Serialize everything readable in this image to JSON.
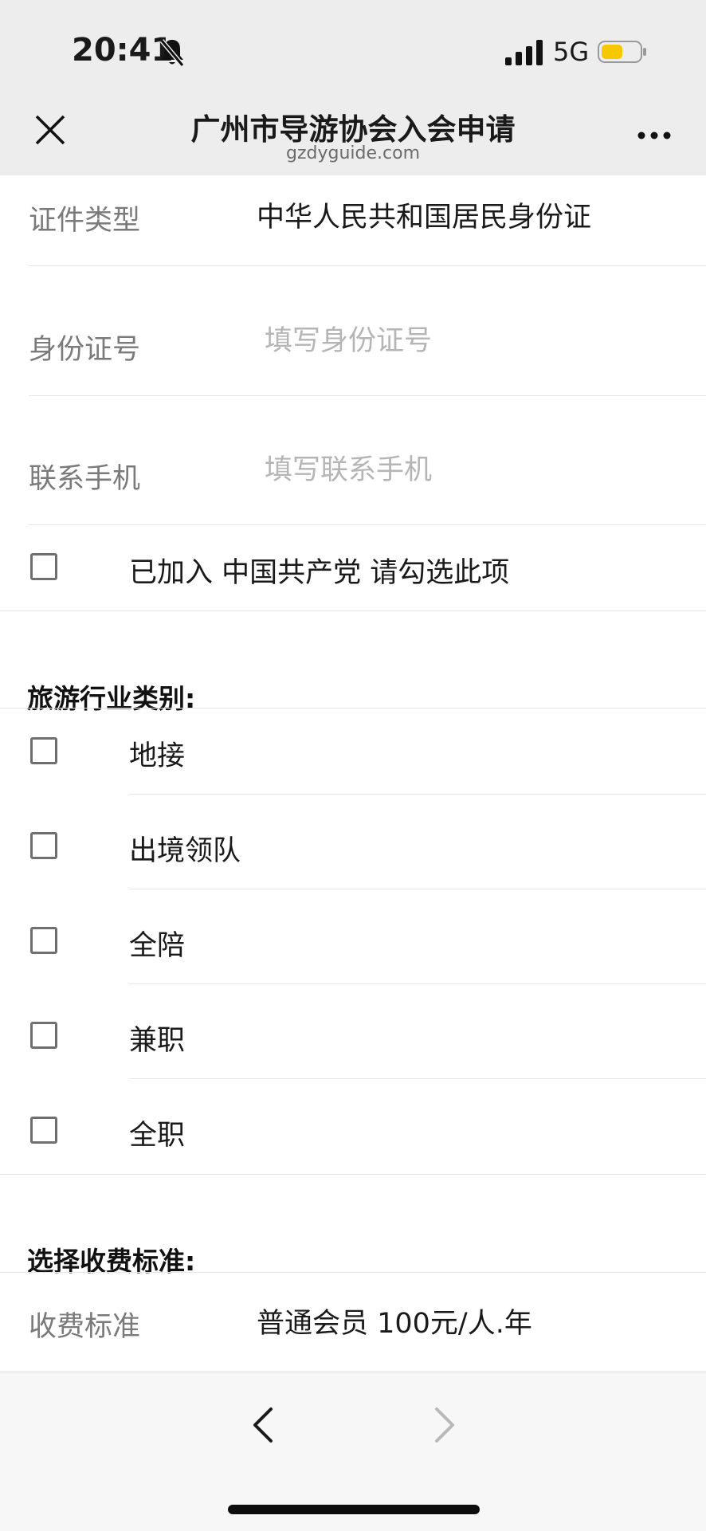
{
  "status_bar": {
    "time": "20:41",
    "network": "5G"
  },
  "nav": {
    "title": "广州市导游协会入会申请",
    "subtitle": "gzdyguide.com"
  },
  "form": {
    "id_type": {
      "label": "证件类型",
      "value": "中华人民共和国居民身份证"
    },
    "id_number": {
      "label": "身份证号",
      "placeholder": "填写身份证号"
    },
    "phone": {
      "label": "联系手机",
      "placeholder": "填写联系手机"
    },
    "party_member": {
      "label": "已加入 中国共产党 请勾选此项"
    }
  },
  "industry": {
    "title": "旅游行业类别:",
    "options": [
      "地接",
      "出境领队",
      "全陪",
      "兼职",
      "全职"
    ]
  },
  "fee": {
    "title": "选择收费标准:",
    "label": "收费标准",
    "value": "普通会员 100元/人.年"
  },
  "colors": {
    "nav_bg": "#ededed",
    "battery_fill": "#f7c700"
  }
}
